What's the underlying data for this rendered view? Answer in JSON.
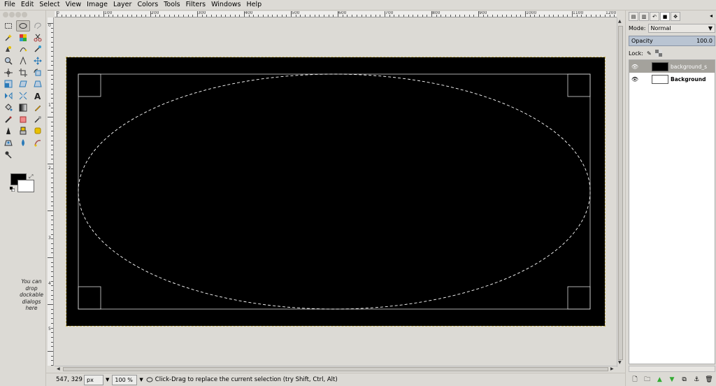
{
  "menu": [
    "File",
    "Edit",
    "Select",
    "View",
    "Image",
    "Layer",
    "Colors",
    "Tools",
    "Filters",
    "Windows",
    "Help"
  ],
  "toolbox": {
    "dock_hint": "You can drop dockable dialogs here"
  },
  "ruler_h": [
    "0",
    "100",
    "200",
    "300",
    "400",
    "500",
    "600",
    "700",
    "800",
    "900",
    "1000",
    "1100",
    "1200"
  ],
  "ruler_v": [
    "0",
    "1",
    "2",
    "3",
    "4",
    "5"
  ],
  "status": {
    "coords": "547, 329",
    "unit": "px",
    "zoom": "100 %",
    "message": "Click-Drag to replace the current selection (try Shift, Ctrl, Alt)"
  },
  "dock": {
    "mode_label": "Mode:",
    "mode_value": "Normal",
    "opacity_label": "Opacity",
    "opacity_value": "100.0",
    "lock_label": "Lock:",
    "layers": [
      {
        "name": "background_s",
        "selected": true,
        "thumb": "#000000"
      },
      {
        "name": "Background",
        "selected": false,
        "thumb": "#ffffff"
      }
    ]
  }
}
